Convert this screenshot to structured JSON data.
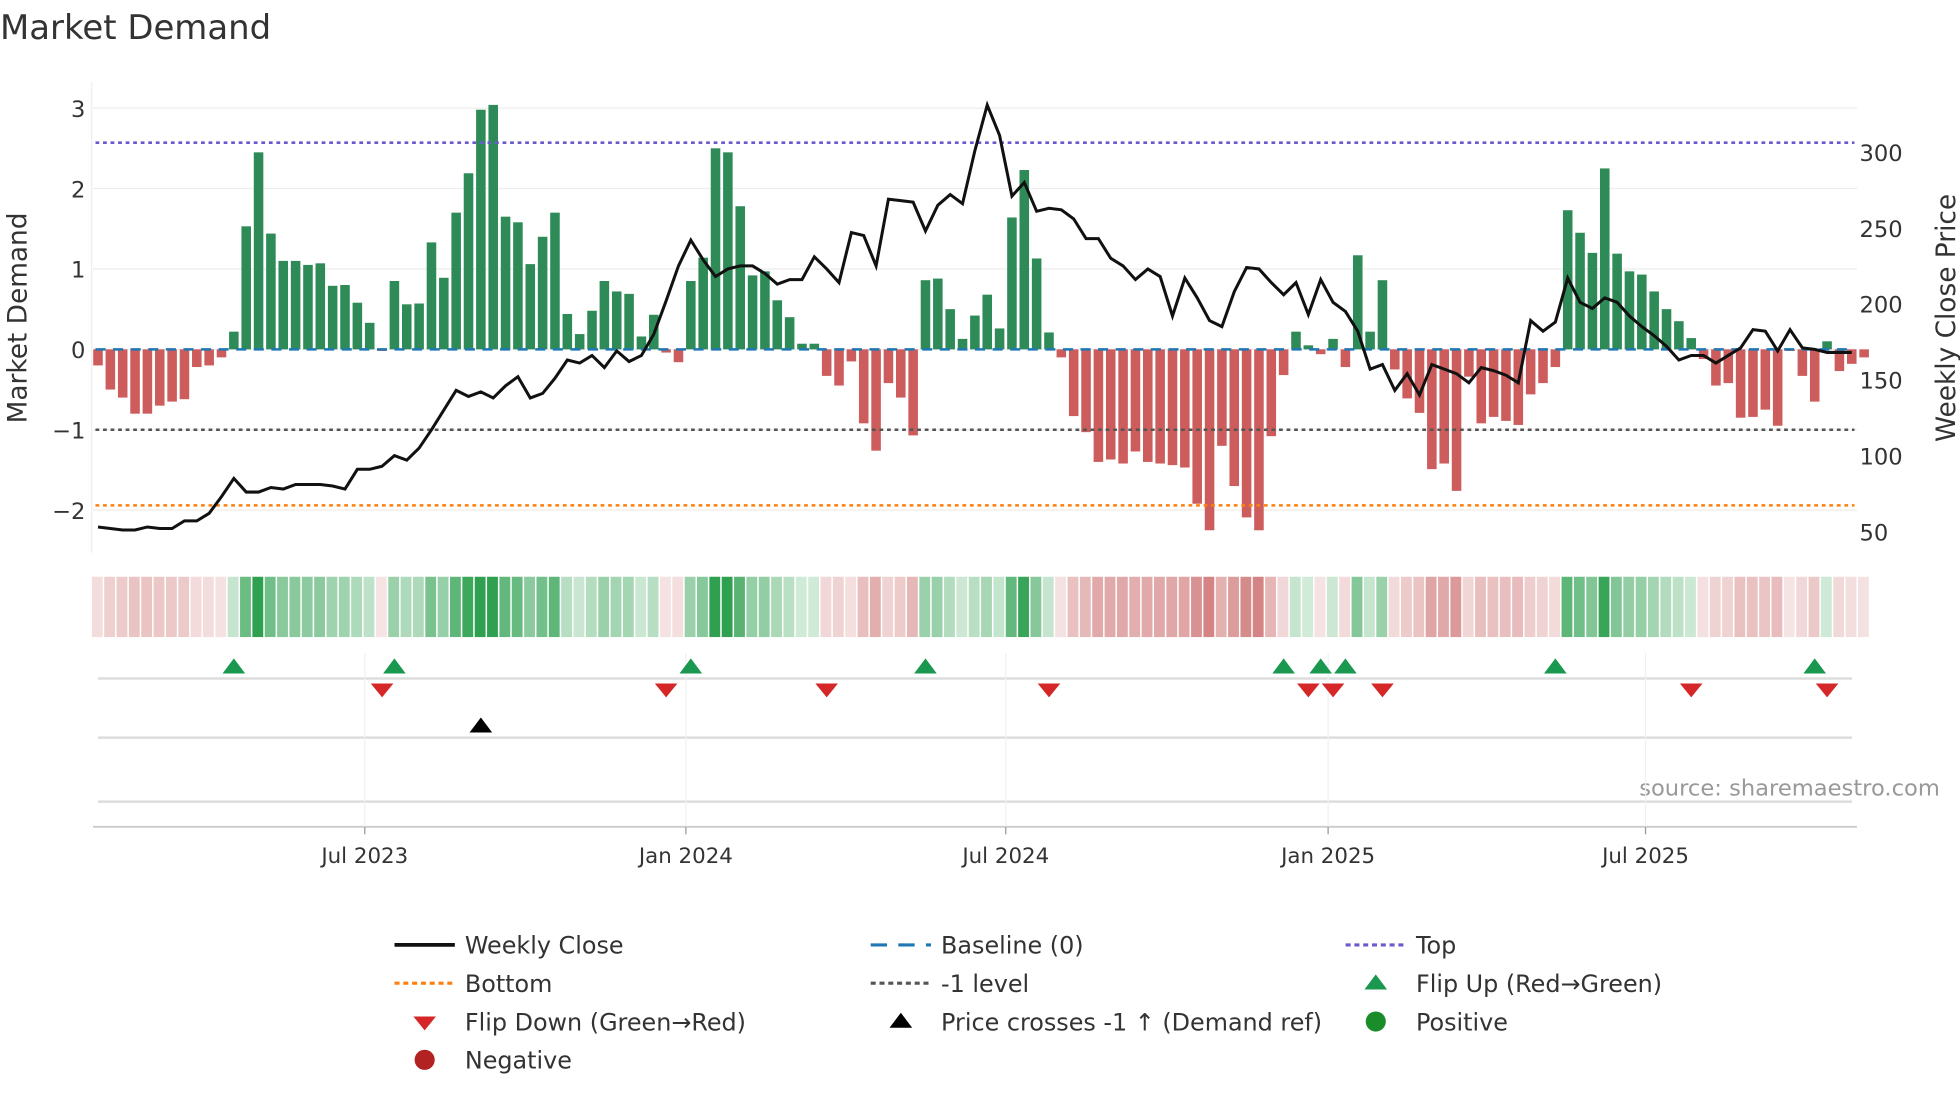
{
  "chart_data": {
    "type": "bar",
    "title": "Market Demand",
    "ylabel": "Market Demand",
    "y2label": "Weekly Close Price",
    "ylim": [
      -2.5,
      3.3
    ],
    "y2lim": [
      47,
      347
    ],
    "yticks": [
      {
        "v": 3,
        "label": "3"
      },
      {
        "v": 2,
        "label": "2"
      },
      {
        "v": 1,
        "label": "1"
      },
      {
        "v": 0,
        "label": "0"
      },
      {
        "v": -1,
        "label": "−1"
      },
      {
        "v": -2,
        "label": "−2"
      }
    ],
    "y2ticks": [
      {
        "v": 300,
        "label": "300"
      },
      {
        "v": 250,
        "label": "250"
      },
      {
        "v": 200,
        "label": "200"
      },
      {
        "v": 150,
        "label": "150"
      },
      {
        "v": 100,
        "label": "100"
      },
      {
        "v": 50,
        "label": "50"
      }
    ],
    "xticks": [
      {
        "week": 21.6,
        "label": "Jul 2023"
      },
      {
        "week": 47.6,
        "label": "Jan 2024"
      },
      {
        "week": 73.5,
        "label": "Jul 2024"
      },
      {
        "week": 99.6,
        "label": "Jan 2025"
      },
      {
        "week": 125.3,
        "label": "Jul 2025"
      }
    ],
    "levels": {
      "top": 2.57,
      "bottom": -1.94,
      "minus_one": -1,
      "baseline": 0
    },
    "demand": [
      -0.2,
      -0.5,
      -0.6,
      -0.8,
      -0.8,
      -0.7,
      -0.65,
      -0.62,
      -0.22,
      -0.2,
      -0.1,
      0.22,
      1.53,
      2.45,
      1.44,
      1.1,
      1.1,
      1.05,
      1.07,
      0.79,
      0.8,
      0.58,
      0.33,
      -0.02,
      0.85,
      0.56,
      0.57,
      1.33,
      0.89,
      1.7,
      2.19,
      2.98,
      3.04,
      1.65,
      1.58,
      1.06,
      1.4,
      1.7,
      0.44,
      0.19,
      0.48,
      0.85,
      0.72,
      0.69,
      0.16,
      0.43,
      -0.04,
      -0.16,
      0.85,
      1.14,
      2.5,
      2.45,
      1.78,
      0.92,
      0.97,
      0.61,
      0.4,
      0.07,
      0.07,
      -0.33,
      -0.45,
      -0.15,
      -0.92,
      -1.26,
      -0.42,
      -0.6,
      -1.07,
      0.86,
      0.88,
      0.5,
      0.13,
      0.42,
      0.68,
      0.26,
      1.64,
      2.23,
      1.13,
      0.21,
      -0.1,
      -0.83,
      -1.03,
      -1.4,
      -1.37,
      -1.42,
      -1.27,
      -1.4,
      -1.42,
      -1.44,
      -1.47,
      -1.92,
      -2.25,
      -1.2,
      -1.7,
      -2.09,
      -2.25,
      -1.08,
      -0.32,
      0.22,
      0.05,
      -0.06,
      0.13,
      -0.22,
      1.17,
      0.22,
      0.86,
      -0.25,
      -0.61,
      -0.79,
      -1.49,
      -1.42,
      -1.76,
      -0.34,
      -0.92,
      -0.84,
      -0.89,
      -0.94,
      -0.56,
      -0.42,
      -0.22,
      1.73,
      1.45,
      1.2,
      2.25,
      1.19,
      0.97,
      0.93,
      0.72,
      0.5,
      0.35,
      0.14,
      -0.12,
      -0.45,
      -0.42,
      -0.85,
      -0.84,
      -0.75,
      -0.95,
      -0.02,
      -0.33,
      -0.65,
      0.1,
      -0.27,
      -0.18,
      -0.1
    ],
    "price": [
      53,
      52,
      51,
      51,
      53,
      52,
      52,
      57,
      57,
      62,
      73,
      85,
      76,
      76,
      79,
      78,
      81,
      81,
      81,
      80,
      78,
      91,
      91,
      93,
      100,
      97,
      105,
      117,
      130,
      143,
      139,
      142,
      138,
      146,
      152,
      138,
      141,
      151,
      163,
      161,
      166,
      158,
      169,
      162,
      166,
      180,
      202,
      225,
      242,
      229,
      218,
      223,
      225,
      225,
      220,
      213,
      216,
      216,
      231,
      223,
      214,
      247,
      245,
      225,
      269,
      268,
      267,
      248,
      265,
      272,
      266,
      301,
      331,
      311,
      271,
      280,
      261,
      263,
      262,
      256,
      243,
      243,
      230,
      225,
      216,
      223,
      218,
      192,
      217,
      204,
      189,
      185,
      208,
      224,
      223,
      214,
      206,
      214,
      193,
      216,
      201,
      195,
      182,
      157,
      160,
      143,
      154,
      140,
      160,
      157,
      154,
      148,
      158,
      156,
      153,
      148,
      189,
      182,
      188,
      217,
      201,
      197,
      204,
      201,
      192,
      185,
      179,
      172,
      163,
      166,
      166,
      161,
      166,
      171,
      183,
      182,
      169,
      183,
      171,
      170,
      168,
      168,
      168
    ],
    "flip_up_weeks": [
      11,
      24,
      48,
      67,
      96,
      99,
      101,
      118,
      139
    ],
    "flip_down_weeks": [
      23,
      46,
      59,
      77,
      98,
      100,
      104,
      129,
      140
    ],
    "price_cross_weeks": [
      31
    ],
    "legend": [
      {
        "label": "Weekly Close",
        "kind": "line",
        "color": "#111111"
      },
      {
        "label": "Baseline (0)",
        "kind": "dash",
        "color": "#1f77b4"
      },
      {
        "label": "Top",
        "kind": "dot",
        "color": "#6a5acd"
      },
      {
        "label": "Bottom",
        "kind": "dot",
        "color": "#ff7f0e"
      },
      {
        "label": "-1 level",
        "kind": "dot",
        "color": "#555555"
      },
      {
        "label": "Flip Up (Red→Green)",
        "kind": "up",
        "color": "#1a9850"
      },
      {
        "label": "Flip Down (Green→Red)",
        "kind": "down",
        "color": "#d62728"
      },
      {
        "label": "Price crosses -1 ↑ (Demand ref)",
        "kind": "up",
        "color": "#000000"
      },
      {
        "label": "Positive",
        "kind": "circle",
        "color": "#1a8c2a"
      },
      {
        "label": "Negative",
        "kind": "circle",
        "color": "#b22222"
      }
    ],
    "source": "source: sharemaestro.com",
    "colors": {
      "pos": "#2e8b57",
      "neg": "#cd5c5c"
    }
  }
}
